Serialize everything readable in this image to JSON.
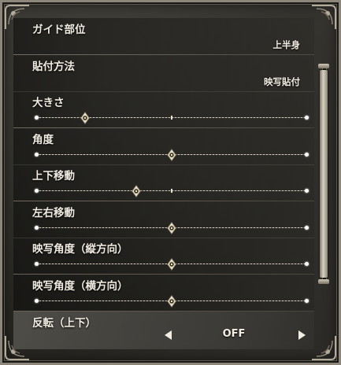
{
  "settings": [
    {
      "label": "ガイド部位",
      "type": "value",
      "value": "上半身",
      "selected": false
    },
    {
      "label": "貼付方法",
      "type": "value",
      "value": "映写貼付",
      "selected": false
    },
    {
      "label": "大きさ",
      "type": "slider",
      "position": 0.18,
      "center_mark": true,
      "selected": false
    },
    {
      "label": "角度",
      "type": "slider",
      "position": 0.5,
      "center_mark": true,
      "selected": false
    },
    {
      "label": "上下移動",
      "type": "slider",
      "position": 0.37,
      "center_mark": true,
      "selected": false
    },
    {
      "label": "左右移動",
      "type": "slider",
      "position": 0.5,
      "center_mark": true,
      "selected": false
    },
    {
      "label": "映写角度（縦方向）",
      "type": "slider",
      "position": 0.5,
      "center_mark": true,
      "selected": false
    },
    {
      "label": "映写角度（横方向）",
      "type": "slider",
      "position": 0.5,
      "center_mark": true,
      "selected": false
    },
    {
      "label": "反転（上下）",
      "type": "toggle",
      "value": "OFF",
      "selected": true
    }
  ],
  "scroll": {
    "position": 0.0
  },
  "colors": {
    "text": "#f0ece2",
    "frame": "#8d877b",
    "knob_ring": "#d8c89a"
  },
  "icons": {
    "left": "arrow-left-icon",
    "right": "arrow-right-icon",
    "knob": "slider-knob-icon"
  }
}
